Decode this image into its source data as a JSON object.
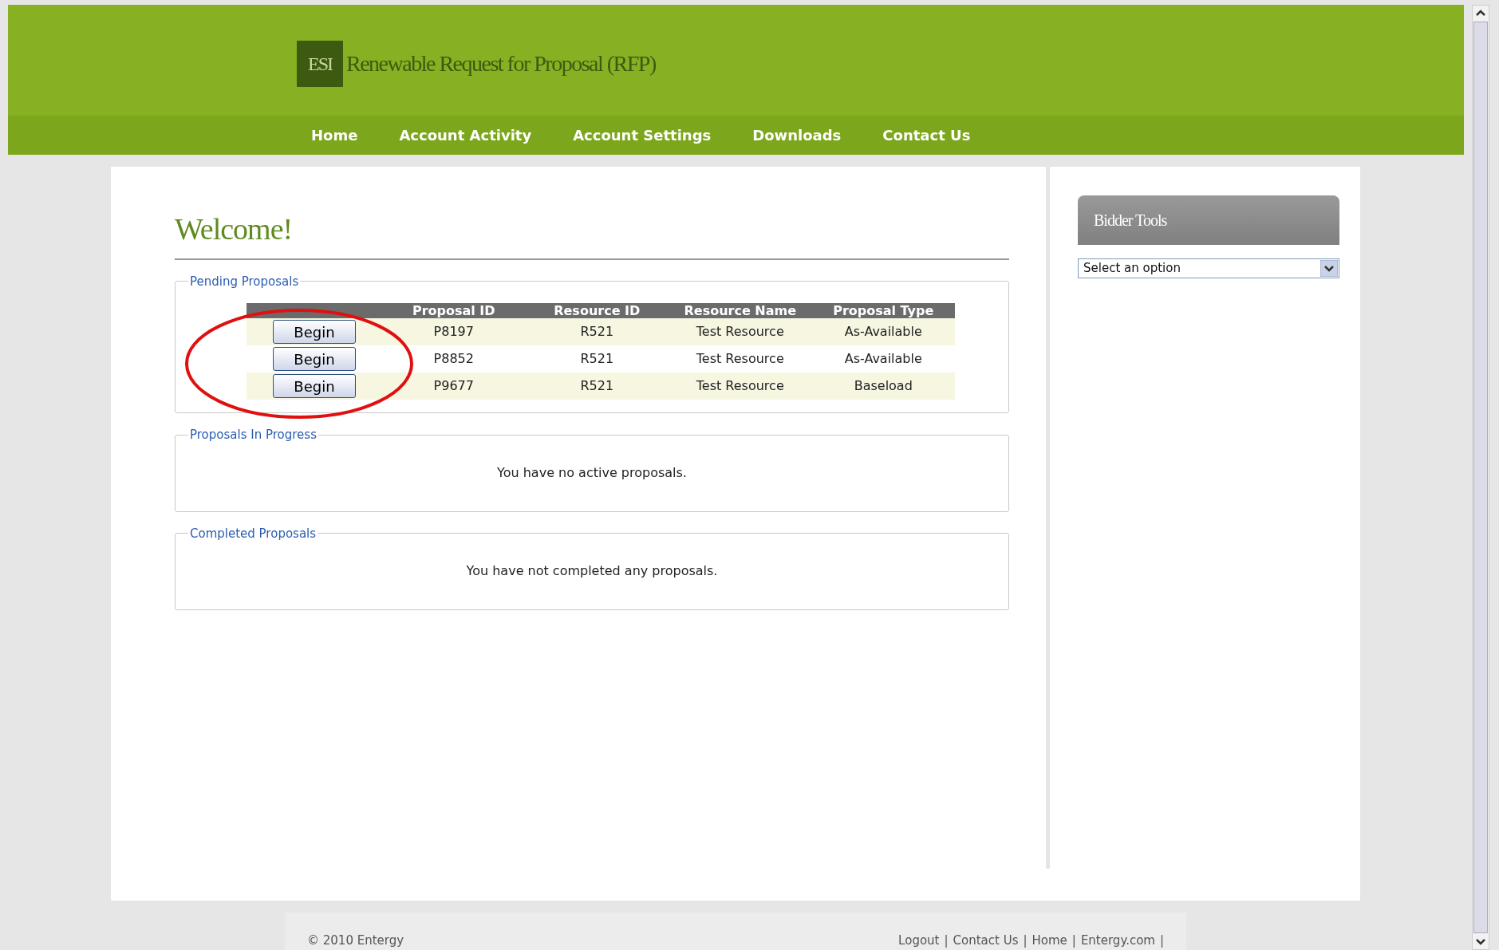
{
  "header": {
    "logo": "ESI",
    "title": "Renewable Request for Proposal (RFP)"
  },
  "nav": [
    {
      "label": "Home"
    },
    {
      "label": "Account Activity"
    },
    {
      "label": "Account Settings"
    },
    {
      "label": "Downloads"
    },
    {
      "label": "Contact Us"
    }
  ],
  "main": {
    "heading": "Welcome!",
    "pending": {
      "legend": "Pending Proposals",
      "columns": [
        "Proposal ID",
        "Resource ID",
        "Resource Name",
        "Proposal Type"
      ],
      "rows": [
        {
          "button": "Begin",
          "cells": [
            "P8197",
            "R521",
            "Test Resource",
            "As-Available"
          ]
        },
        {
          "button": "Begin",
          "cells": [
            "P8852",
            "R521",
            "Test Resource",
            "As-Available"
          ]
        },
        {
          "button": "Begin",
          "cells": [
            "P9677",
            "R521",
            "Test Resource",
            "Baseload"
          ]
        }
      ]
    },
    "in_progress": {
      "legend": "Proposals In Progress",
      "message": "You have no active proposals."
    },
    "completed": {
      "legend": "Completed Proposals",
      "message": "You have not completed any proposals."
    }
  },
  "sidebar": {
    "title": "Bidder Tools",
    "select": {
      "value": "Select an option"
    }
  },
  "footer": {
    "copyright": "© 2010 Entergy",
    "links": [
      "Logout",
      "Contact Us",
      "Home",
      "Entergy.com"
    ],
    "separator": "|"
  }
}
